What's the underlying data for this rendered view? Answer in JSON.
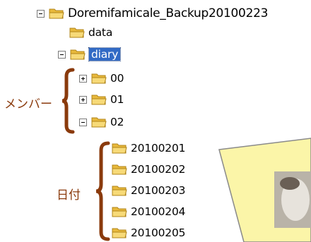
{
  "tree": {
    "root": {
      "label": "Doremifamicale_Backup20100223",
      "expanded": true
    },
    "data_folder": {
      "label": "data"
    },
    "diary_folder": {
      "label": "diary",
      "expanded": true,
      "selected": true
    },
    "members": [
      {
        "label": "00",
        "expanded": false
      },
      {
        "label": "01",
        "expanded": false
      },
      {
        "label": "02",
        "expanded": true
      }
    ],
    "dates": [
      {
        "label": "20100201"
      },
      {
        "label": "20100202"
      },
      {
        "label": "20100203"
      },
      {
        "label": "20100204"
      },
      {
        "label": "20100205"
      }
    ]
  },
  "annotations": {
    "members_label": "メンバー",
    "dates_label": "日付"
  },
  "colors": {
    "annotation": "#8a3a0c",
    "selection": "#316ac5",
    "folder": "#f5d36b",
    "callout_fill": "#fbf5a8"
  }
}
